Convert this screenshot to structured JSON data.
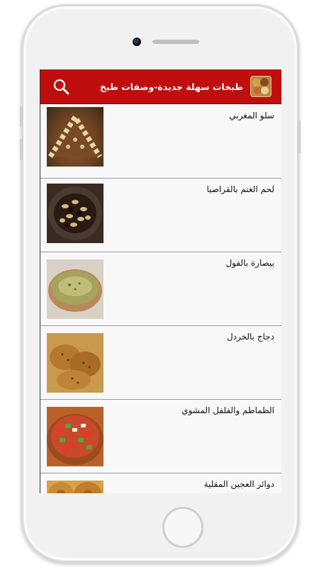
{
  "app": {
    "title": "طبخات سهلة جديدة-وصفات طبخ",
    "search_icon": "search-icon",
    "logo_icon": "food-plate-logo",
    "accent_color": "#c00d0d"
  },
  "recipes": [
    {
      "title": "سلو المغربي",
      "thumb": "sellou-dish"
    },
    {
      "title": "لحم الغنم بالقراصيا",
      "thumb": "lamb-prunes-dish"
    },
    {
      "title": "بيصارة بالفول",
      "thumb": "bean-soup-bowl"
    },
    {
      "title": "دجاج بالخردل",
      "thumb": "mustard-chicken"
    },
    {
      "title": "الطماطم والفلفل المشوي",
      "thumb": "tomato-pepper-salad"
    },
    {
      "title": "دوائر العجين المقلية",
      "thumb": "fried-dough-rings"
    }
  ]
}
